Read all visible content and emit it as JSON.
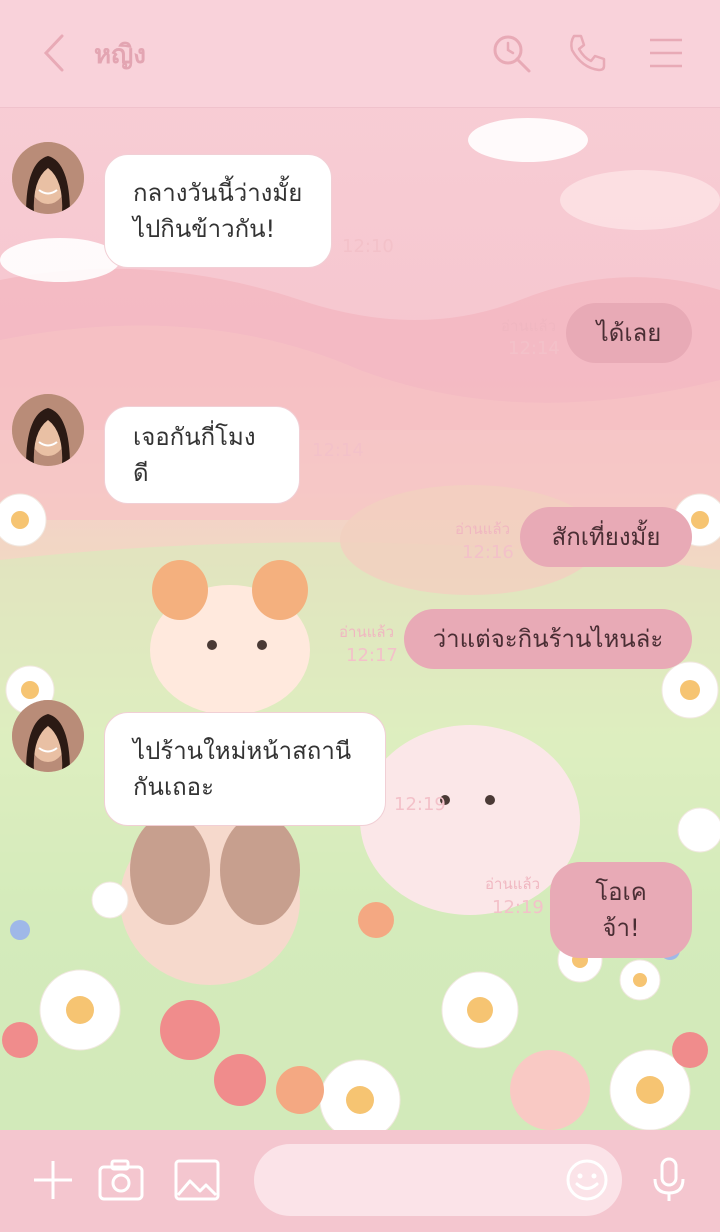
{
  "header": {
    "contact_name": "หญิง"
  },
  "messages": [
    {
      "type": "in",
      "lines": [
        "กลางวันนี้ว่างมั้ย",
        "ไปกินข้าวกัน!"
      ],
      "time": "12:10"
    },
    {
      "type": "out",
      "text": "ได้เลย",
      "read": "อ่านแล้ว",
      "time": "12:14"
    },
    {
      "type": "in",
      "text": "เจอกันกี่โมงดี",
      "time": "12:14"
    },
    {
      "type": "out",
      "text": "สักเที่ยงมั้ย",
      "read": "อ่านแล้ว",
      "time": "12:16"
    },
    {
      "type": "out",
      "text": "ว่าแต่จะกินร้านไหนล่ะ",
      "read": "อ่านแล้ว",
      "time": "12:17"
    },
    {
      "type": "in",
      "lines": [
        "ไปร้านใหม่หน้าสถานี",
        "กันเถอะ"
      ],
      "time": "12:19"
    },
    {
      "type": "out",
      "text": "โอเคจ้า!",
      "read": "อ่านแล้ว",
      "time": "12:19"
    }
  ],
  "footer": {
    "input_value": ""
  },
  "colors": {
    "header_bg": "#f9d2da",
    "header_icon": "#e8aab6",
    "outgoing_bubble": "#e8aab6",
    "incoming_bubble": "#ffffff",
    "footer_bg": "#f4c6cf"
  },
  "icons": [
    "back-icon",
    "search-icon",
    "phone-icon",
    "menu-icon",
    "plus-icon",
    "camera-icon",
    "image-icon",
    "emoji-icon",
    "mic-icon"
  ]
}
